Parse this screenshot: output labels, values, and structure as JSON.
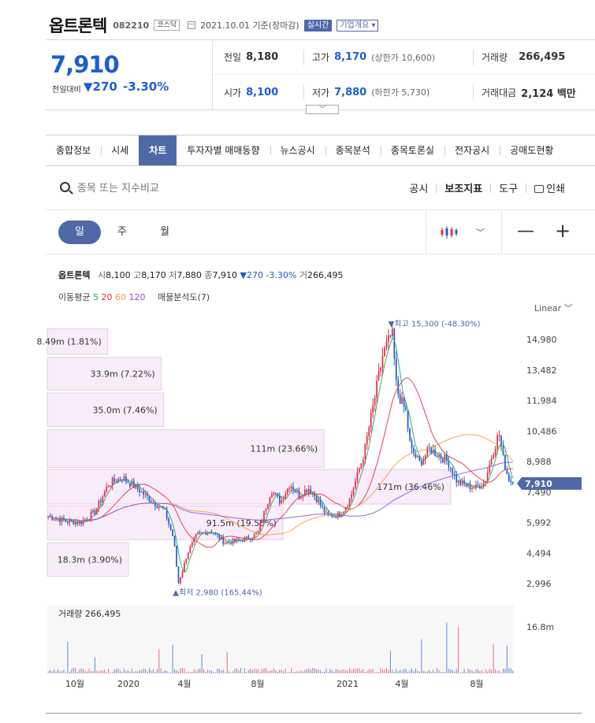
{
  "header": {
    "name": "옵트론텍",
    "code": "082210",
    "market": "코스닥",
    "date": "2021.10.01 기준(장마감)",
    "live_label": "실시간",
    "info_label": "기업개요"
  },
  "quote": {
    "price": "7,910",
    "change_label": "전일대비",
    "change_amount": "▼270",
    "change_percent": "-3.30%",
    "prev_close": {
      "label": "전일",
      "value": "8,180"
    },
    "high": {
      "label": "고가",
      "value": "8,170",
      "extra": "(상한가 10,600)"
    },
    "volume": {
      "label": "거래량",
      "value": "266,495"
    },
    "open": {
      "label": "시가",
      "value": "8,100"
    },
    "low": {
      "label": "저가",
      "value": "7,880",
      "extra": "(하한가 5,730)"
    },
    "amount": {
      "label": "거래대금",
      "value": "2,124 백만"
    }
  },
  "tabs": [
    "종합정보",
    "시세",
    "차트",
    "투자자별 매매동향",
    "뉴스공시",
    "종목분석",
    "종목토론실",
    "전자공시",
    "공매도현황"
  ],
  "active_tab": "차트",
  "search": {
    "placeholder": "종목 또는 지수비교"
  },
  "tools": {
    "disclosure": "공시",
    "indicator": "보조지표",
    "tool": "도구",
    "print": "인쇄"
  },
  "periods": {
    "day": "일",
    "week": "주",
    "month": "월"
  },
  "legend": {
    "name": "옵트론텍",
    "open_lbl": "시",
    "open": "8,100",
    "high_lbl": "고",
    "high": "8,170",
    "low_lbl": "저",
    "low": "7,880",
    "close_lbl": "종",
    "close": "7,910",
    "change": "▼270 -3.30%",
    "vol_lbl": "거",
    "vol": "266,495",
    "ma_label": "이동평균",
    "ma5": "5",
    "ma20": "20",
    "ma60": "60",
    "ma120": "120",
    "vp_label": "매물분석도(7)"
  },
  "scale_label": "Linear",
  "colors": {
    "up": "#e0304a",
    "down": "#1b5fd1",
    "accent": "#4e69a6",
    "ma5": "#23a65a",
    "ma20": "#e0304a",
    "ma60": "#f39a3a",
    "ma120": "#8a55d8"
  },
  "chart_data": {
    "type": "candlestick",
    "price_axis": {
      "ticks": [
        "14,980",
        "13,482",
        "11,984",
        "10,486",
        "8,988",
        "7,490",
        "5,992",
        "4,494",
        "2,996"
      ],
      "tick_values": [
        14980,
        13482,
        11984,
        10486,
        8988,
        7490,
        5992,
        4494,
        2996
      ],
      "ylim": [
        2500,
        15500
      ]
    },
    "current_price": {
      "value": 7910,
      "label": "7,910"
    },
    "max_annotation": {
      "label": "▼최고 15,300 (-48.30%)",
      "value": 15300
    },
    "min_annotation": {
      "label": "▲최저 2,980 (165.44%)",
      "value": 2980
    },
    "volume_profile": [
      {
        "label": "8.49m (1.81%)",
        "low": 14250,
        "high": 15500,
        "share": 1.81
      },
      {
        "label": "33.9m (7.22%)",
        "low": 12500,
        "high": 14100,
        "share": 7.22
      },
      {
        "label": "35.0m (7.46%)",
        "low": 10700,
        "high": 12350,
        "share": 7.46
      },
      {
        "label": "111m (23.66%)",
        "low": 8700,
        "high": 10550,
        "share": 23.66
      },
      {
        "label": "171m (36.46%)",
        "low": 6900,
        "high": 8600,
        "share": 36.46
      },
      {
        "label": "91.5m (19.50%)",
        "low": 5150,
        "high": 6800,
        "share": 19.5
      },
      {
        "label": "18.3m (3.90%)",
        "low": 3350,
        "high": 5000,
        "share": 3.9
      }
    ],
    "time_axis": [
      "10월",
      "2020",
      "4월",
      "8월",
      "2021",
      "4월",
      "8월"
    ],
    "volume_panel": {
      "label": "거래량 266,495",
      "max_tick": "16.8m"
    },
    "close_path": [
      [
        0,
        6300
      ],
      [
        0.04,
        6050
      ],
      [
        0.07,
        6000
      ],
      [
        0.1,
        6500
      ],
      [
        0.13,
        7900
      ],
      [
        0.16,
        8200
      ],
      [
        0.19,
        7700
      ],
      [
        0.22,
        7100
      ],
      [
        0.25,
        6600
      ],
      [
        0.27,
        5200
      ],
      [
        0.28,
        3000
      ],
      [
        0.3,
        4500
      ],
      [
        0.32,
        5400
      ],
      [
        0.35,
        5600
      ],
      [
        0.38,
        5000
      ],
      [
        0.42,
        5150
      ],
      [
        0.45,
        5400
      ],
      [
        0.48,
        7600
      ],
      [
        0.5,
        7000
      ],
      [
        0.52,
        7900
      ],
      [
        0.54,
        7300
      ],
      [
        0.56,
        7700
      ],
      [
        0.58,
        7100
      ],
      [
        0.6,
        6300
      ],
      [
        0.63,
        6400
      ],
      [
        0.65,
        7200
      ],
      [
        0.68,
        9400
      ],
      [
        0.7,
        11800
      ],
      [
        0.72,
        14200
      ],
      [
        0.74,
        15300
      ],
      [
        0.75,
        12500
      ],
      [
        0.77,
        11400
      ],
      [
        0.78,
        9600
      ],
      [
        0.8,
        8900
      ],
      [
        0.82,
        9600
      ],
      [
        0.84,
        9300
      ],
      [
        0.86,
        9000
      ],
      [
        0.88,
        8000
      ],
      [
        0.9,
        7800
      ],
      [
        0.92,
        7700
      ],
      [
        0.94,
        8000
      ],
      [
        0.955,
        9300
      ],
      [
        0.97,
        10400
      ],
      [
        0.98,
        9000
      ],
      [
        0.99,
        8200
      ],
      [
        1,
        7910
      ]
    ]
  }
}
